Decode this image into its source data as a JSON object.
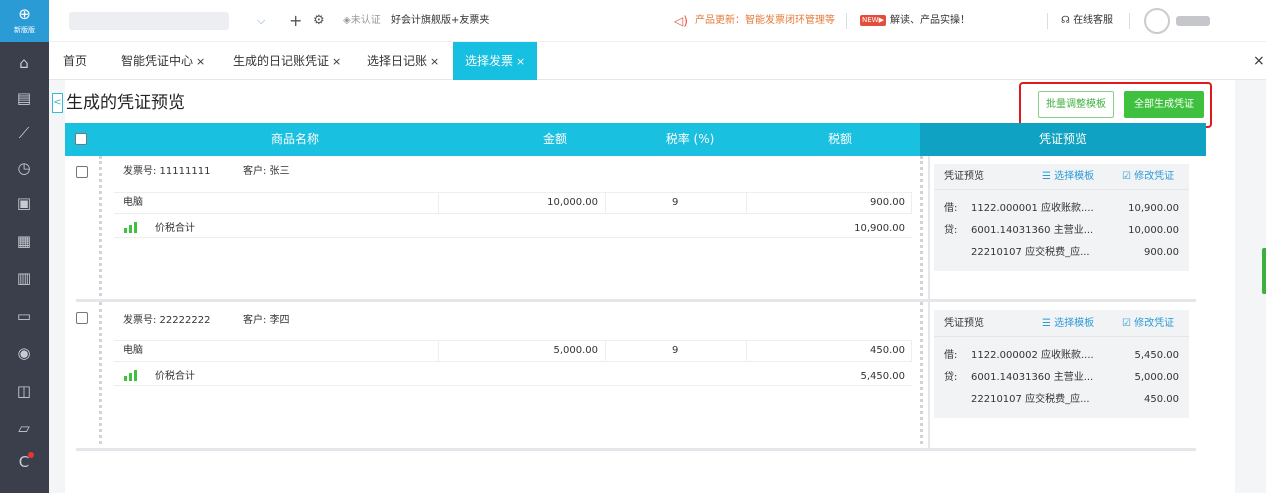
{
  "leftnav": {
    "logo_glyph": "⊕",
    "logo_text": "新版版",
    "icons": [
      "home-icon",
      "voucher-icon",
      "report-icon",
      "payroll-icon",
      "asset-icon",
      "invoice-icon",
      "tax-icon",
      "bank-icon",
      "stock-icon",
      "inbox-icon",
      "cashier-icon"
    ]
  },
  "topbar": {
    "add_glyph": "+",
    "settings_glyph": "⚙",
    "cert_status": "未认证",
    "edition": "好会计旗舰版+友票夹",
    "update_notice": "产品更新：智能发票闭环管理等",
    "video_notice": "解读、产品实操！",
    "service": "在线客服",
    "chevron": "⌵"
  },
  "tabs": [
    {
      "label": "首页",
      "closable": false
    },
    {
      "label": "智能凭证中心",
      "closable": true
    },
    {
      "label": "生成的日记账凭证",
      "closable": true
    },
    {
      "label": "选择日记账",
      "closable": true
    },
    {
      "label": "选择发票",
      "closable": true,
      "active": true
    }
  ],
  "close_glyph": "×",
  "page": {
    "title": "生成的凭证预览",
    "collapse_glyph": "<",
    "batch_button": "批量调整模板",
    "generate_all_button": "全部生成凭证"
  },
  "table": {
    "headers": {
      "name": "商品名称",
      "amount": "金额",
      "rate": "税率 (%)",
      "tax": "税额",
      "preview": "凭证预览"
    }
  },
  "invoices": [
    {
      "invoice_label": "发票号: 11111111",
      "customer_label": "客户: 张三",
      "item": "电脑",
      "amount": "10,000.00",
      "rate": "9",
      "tax": "900.00",
      "total_label": "价税合计",
      "total": "10,900.00",
      "preview": {
        "title": "凭证预览",
        "select_template": "选择模板",
        "edit_voucher": "修改凭证",
        "lines": [
          {
            "dc": "借:",
            "account": "1122.000001 应收账款....",
            "value": "10,900.00"
          },
          {
            "dc": "贷:",
            "account": "6001.14031360 主营业...",
            "value": "10,000.00"
          },
          {
            "dc": "",
            "account": "22210107 应交税费_应...",
            "value": "900.00"
          }
        ]
      }
    },
    {
      "invoice_label": "发票号: 22222222",
      "customer_label": "客户: 李四",
      "item": "电脑",
      "amount": "5,000.00",
      "rate": "9",
      "tax": "450.00",
      "total_label": "价税合计",
      "total": "5,450.00",
      "preview": {
        "title": "凭证预览",
        "select_template": "选择模板",
        "edit_voucher": "修改凭证",
        "lines": [
          {
            "dc": "借:",
            "account": "1122.000002 应收账款....",
            "value": "5,450.00"
          },
          {
            "dc": "贷:",
            "account": "6001.14031360 主营业...",
            "value": "5,000.00"
          },
          {
            "dc": "",
            "account": "22210107 应交税费_应...",
            "value": "450.00"
          }
        ]
      }
    }
  ],
  "colors": {
    "accent": "#19c0df",
    "preview_header": "#0fa2c2",
    "green": "#3fc13f",
    "highlight": "#e0191b",
    "sidebar": "#3a3f4b"
  }
}
